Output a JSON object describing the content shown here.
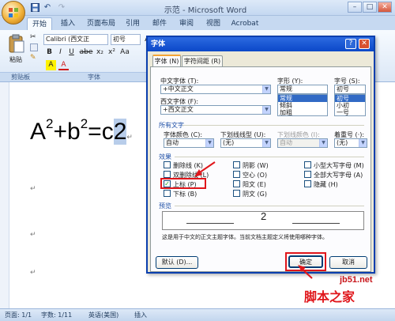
{
  "window": {
    "title": "示范 - Microsoft Word",
    "controls": {
      "minimize": "–",
      "maximize": "□",
      "close": "✕"
    }
  },
  "quick_access": {
    "save_icon": "save-icon",
    "undo_icon": "undo-icon",
    "redo_icon": "redo-icon",
    "undo_glyph": "↶",
    "redo_glyph": "↷"
  },
  "tabs": [
    {
      "label": "开始",
      "active": true
    },
    {
      "label": "插入"
    },
    {
      "label": "页面布局"
    },
    {
      "label": "引用"
    },
    {
      "label": "邮件"
    },
    {
      "label": "审阅"
    },
    {
      "label": "视图"
    },
    {
      "label": "Acrobat"
    }
  ],
  "ribbon": {
    "paste_label": "粘贴",
    "clipboard_group": "剪贴板",
    "font_group": "字体",
    "font_name": "Calibri (西文正",
    "font_size": "初号",
    "bold": "B",
    "italic": "I",
    "underline": "U",
    "strikethrough": "abe",
    "subscript": "x₂",
    "superscript": "x²",
    "aa": "Aa",
    "highlight": "A",
    "font_color": "A",
    "grow": "A",
    "shrink": "A"
  },
  "document": {
    "formula_a": "A",
    "sup_a": "2",
    "plus": "+b",
    "sup_b": "2",
    "equals": "=c",
    "selected": "2",
    "paragraph_mark": "↵"
  },
  "status": {
    "page": "页面: 1/1",
    "words": "字数: 1/11",
    "lang": "英语(美国)",
    "insert": "插入"
  },
  "dialog": {
    "title": "字体",
    "help": "?",
    "close": "✕",
    "tab_font": "字体 (N)",
    "tab_spacing": "字符间距 (R)",
    "cn_font_label": "中文字体 (T):",
    "cn_font_value": "+中文正文",
    "latin_font_label": "西文字体 (F):",
    "latin_font_value": "+西文正文",
    "style_label": "字形 (Y):",
    "style_value": "常规",
    "style_options": [
      "常规",
      "倾斜",
      "加粗"
    ],
    "style_selected": 0,
    "size_label": "字号 (S):",
    "size_value": "初号",
    "size_options": [
      "初号",
      "小初",
      "一号"
    ],
    "size_selected": 0,
    "all_text": "所有文字",
    "color_label": "字体颜色 (C):",
    "color_value": "自动",
    "underline_label": "下划线线型 (U):",
    "underline_value": "(无)",
    "underline_color_label": "下划线颜色 (I):",
    "underline_color_value": "自动",
    "emphasis_label": "着重号 (·):",
    "emphasis_value": "(无)",
    "effects_label": "效果",
    "effects": [
      {
        "label": "删除线 (K)",
        "checked": false
      },
      {
        "label": "双删除线 (L)",
        "checked": false
      },
      {
        "label": "上标 (P)",
        "checked": true
      },
      {
        "label": "下标 (B)",
        "checked": false
      },
      {
        "label": "阴影 (W)",
        "checked": false
      },
      {
        "label": "空心 (O)",
        "checked": false
      },
      {
        "label": "阳文 (E)",
        "checked": false
      },
      {
        "label": "阴文 (G)",
        "checked": false
      },
      {
        "label": "小型大写字母 (M)",
        "checked": false
      },
      {
        "label": "全部大写字母 (A)",
        "checked": false
      },
      {
        "label": "隐藏 (H)",
        "checked": false
      }
    ],
    "preview_label": "预览",
    "preview_text": "2",
    "preview_note": "这是用于中文的正文主题字体。当前文档主题定义将使用哪种字体。",
    "default_button": "默认 (D)...",
    "ok_button": "确定",
    "cancel_button": "取消"
  },
  "watermark": {
    "brand": "脚本之家",
    "url": "jb51.net"
  },
  "colors": {
    "accent_red": "#e0161b",
    "dialog_title": "#0b48c8",
    "ribbon": "#dbe7f6"
  }
}
